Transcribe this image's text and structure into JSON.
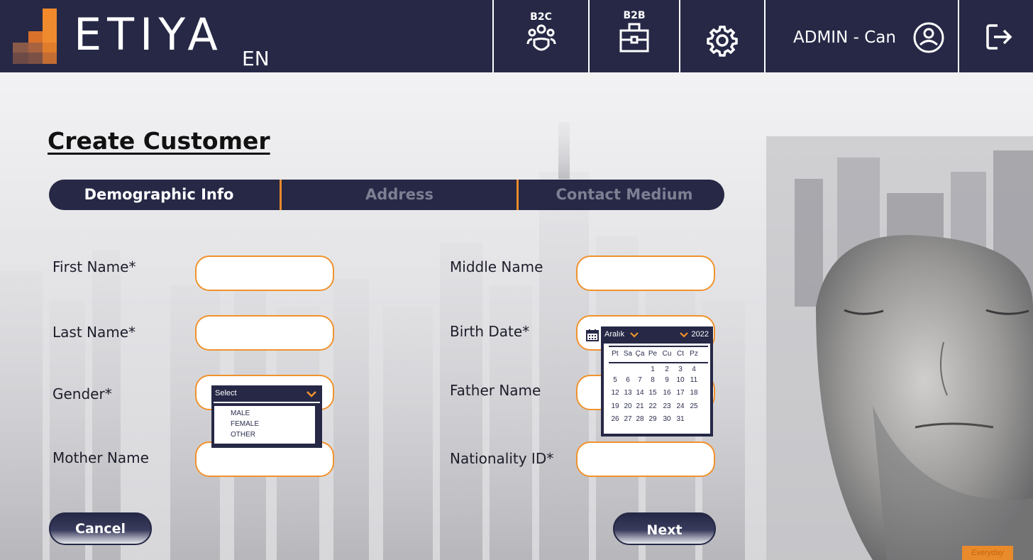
{
  "header": {
    "brand": "ETIYA",
    "language": "EN",
    "b2c_label": "B2C",
    "b2b_label": "B2B",
    "user": "ADMIN - Can"
  },
  "page": {
    "title": "Create Customer"
  },
  "steps": [
    {
      "label": "Demographic Info",
      "active": true
    },
    {
      "label": "Address",
      "active": false
    },
    {
      "label": "Contact Medium",
      "active": false
    }
  ],
  "form": {
    "first_name_label": "First Name*",
    "last_name_label": "Last Name*",
    "gender_label": "Gender*",
    "mother_name_label": "Mother Name",
    "middle_name_label": "Middle Name",
    "birth_date_label": "Birth Date*",
    "father_name_label": "Father Name",
    "nationality_id_label": "Nationality ID*"
  },
  "gender_dropdown": {
    "placeholder": "Select",
    "options": [
      "MALE",
      "FEMALE",
      "OTHER"
    ]
  },
  "calendar": {
    "month": "Aralık",
    "year": "2022",
    "weekdays": [
      "Pt",
      "Sa",
      "Ça",
      "Pe",
      "Cu",
      "Ct",
      "Pz"
    ],
    "weeks": [
      [
        "",
        "",
        "",
        "1",
        "2",
        "3",
        "4"
      ],
      [
        "5",
        "6",
        "7",
        "8",
        "9",
        "10",
        "11"
      ],
      [
        "12",
        "13",
        "14",
        "15",
        "16",
        "17",
        "18"
      ],
      [
        "19",
        "20",
        "21",
        "22",
        "23",
        "24",
        "25"
      ],
      [
        "26",
        "27",
        "28",
        "29",
        "30",
        "31",
        ""
      ]
    ]
  },
  "actions": {
    "cancel": "Cancel",
    "next": "Next"
  },
  "badge": "Everyday",
  "colors": {
    "navy": "#262846",
    "accent": "#f0922d"
  }
}
